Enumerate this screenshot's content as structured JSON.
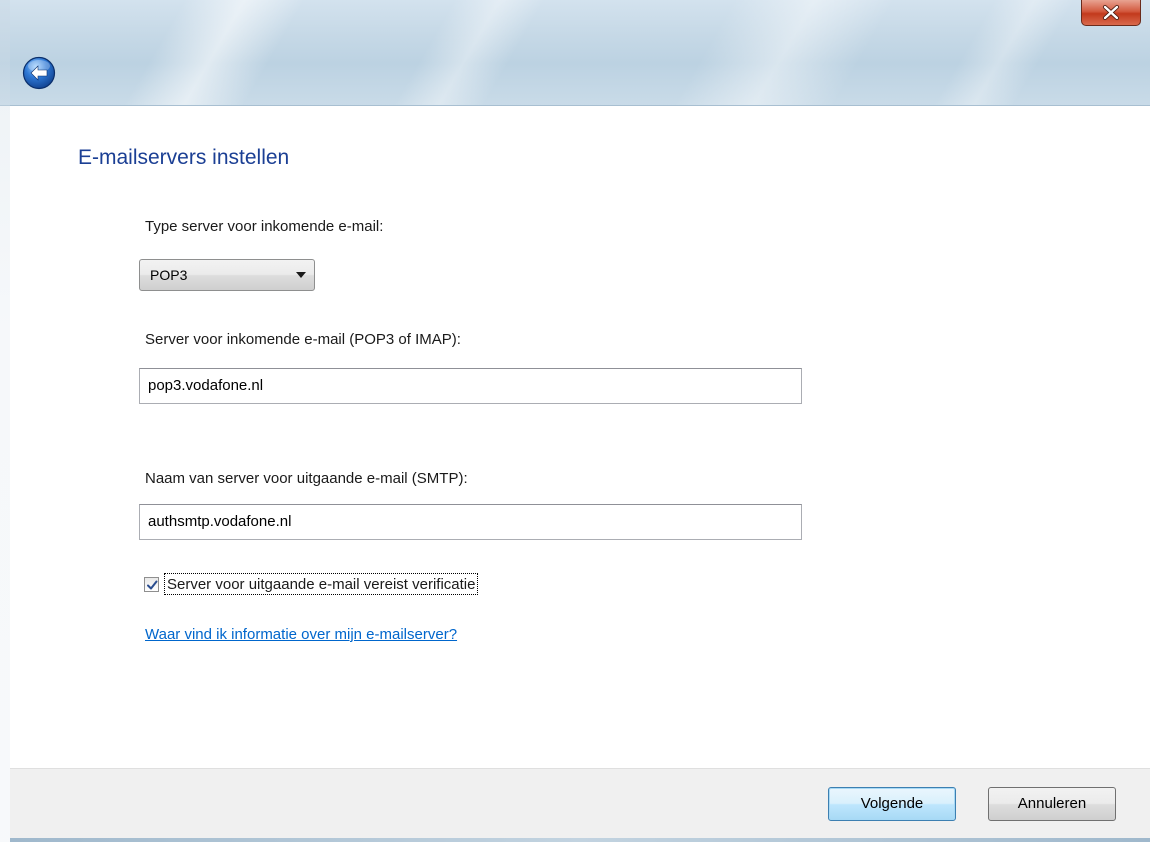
{
  "window": {
    "close_icon": "close-icon",
    "back_icon": "back-arrow-icon",
    "accent_color": "#1b3f94",
    "close_color": "#c23a1d"
  },
  "page": {
    "title": "E-mailservers instellen"
  },
  "incoming_type": {
    "label": "Type server voor inkomende e-mail:",
    "selected": "POP3",
    "icon": "chevron-down-icon"
  },
  "incoming_server": {
    "label": "Server voor inkomende e-mail (POP3 of IMAP):",
    "value": "pop3.vodafone.nl"
  },
  "outgoing_server": {
    "label": "Naam van server voor uitgaande e-mail (SMTP):",
    "value": "authsmtp.vodafone.nl"
  },
  "auth_checkbox": {
    "label": "Server voor uitgaande e-mail vereist verificatie",
    "checked": true,
    "icon": "check-icon"
  },
  "help": {
    "link_text": "Waar vind ik informatie over mijn e-mailserver?",
    "link_color": "#0066cc"
  },
  "footer": {
    "next_label": "Volgende",
    "cancel_label": "Annuleren"
  }
}
